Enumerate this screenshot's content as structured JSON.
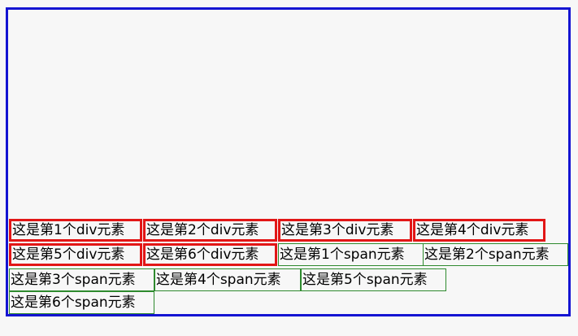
{
  "divs": [
    {
      "label": "这是第1个div元素"
    },
    {
      "label": "这是第2个div元素"
    },
    {
      "label": "这是第3个div元素"
    },
    {
      "label": "这是第4个div元素"
    },
    {
      "label": "这是第5个div元素"
    },
    {
      "label": "这是第6个div元素"
    }
  ],
  "spans": [
    {
      "label": "这是第1个span元素"
    },
    {
      "label": "这是第2个span元素"
    },
    {
      "label": "这是第3个span元素"
    },
    {
      "label": "这是第4个span元素"
    },
    {
      "label": "这是第5个span元素"
    },
    {
      "label": "这是第6个span元素"
    }
  ],
  "colors": {
    "container_border": "#1414d2",
    "div_border": "#e21616",
    "span_border": "#2e8a2e",
    "background": "#f7f7f7"
  }
}
